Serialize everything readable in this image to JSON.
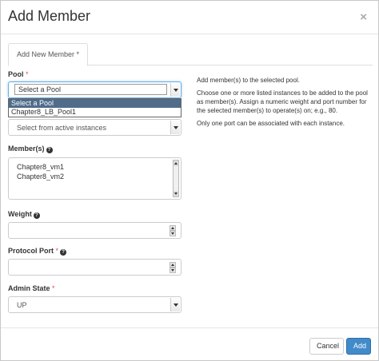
{
  "modal": {
    "title": "Add Member",
    "close_symbol": "×"
  },
  "tabs": [
    {
      "label": "Add New Member",
      "required_mark": "*"
    }
  ],
  "form": {
    "pool": {
      "label": "Pool",
      "required_mark": "*",
      "selected": "Select a Pool",
      "options": [
        "Select a Pool",
        "Chapter8_LB_Pool1"
      ]
    },
    "member_source": {
      "selected": "Select from active instances"
    },
    "members": {
      "label": "Member(s)",
      "help_icon": "question-circle-icon",
      "items": [
        "Chapter8_vm1",
        "Chapter8_vm2"
      ]
    },
    "weight": {
      "label": "Weight",
      "help_icon": "question-circle-icon",
      "value": ""
    },
    "protocol_port": {
      "label": "Protocol Port",
      "required_mark": "*",
      "help_icon": "question-circle-icon",
      "value": ""
    },
    "admin_state": {
      "label": "Admin State",
      "required_mark": "*",
      "selected": "UP"
    }
  },
  "help_text": [
    "Add member(s) to the selected pool.",
    "Choose one or more listed instances to be added to the pool as member(s). Assign a numeric weight and port number for the selected member(s) to operate(s) on; e.g., 80.",
    "Only one port can be associated with each instance."
  ],
  "footer": {
    "cancel_label": "Cancel",
    "add_label": "Add"
  },
  "colors": {
    "primary": "#428bca",
    "required": "#d9534f",
    "dropdown_selected": "#506c8a"
  }
}
